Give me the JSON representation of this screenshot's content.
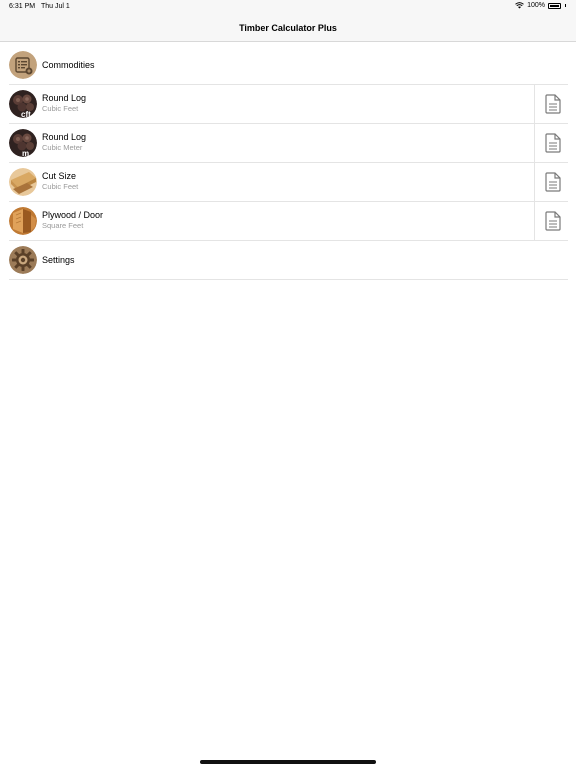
{
  "status": {
    "time": "6:31 PM",
    "date": "Thu Jul 1",
    "battery": "100%",
    "battery_level": 1.0
  },
  "nav": {
    "title": "Timber Calculator Plus"
  },
  "items": [
    {
      "title": "Commodities",
      "subtitle": "",
      "icon": "commodities-icon",
      "color": "#b89870"
    },
    {
      "title": "Round Log",
      "subtitle": "Cubic Feet",
      "icon": "round-log-cft-icon",
      "color": "#4a3330"
    },
    {
      "title": "Round Log",
      "subtitle": "Cubic Meter",
      "icon": "round-log-cbm-icon",
      "color": "#4a3330"
    },
    {
      "title": "Cut Size",
      "subtitle": "Cubic Feet",
      "icon": "cut-size-icon",
      "color": "#d2a870"
    },
    {
      "title": "Plywood / Door",
      "subtitle": "Square Feet",
      "icon": "plywood-icon",
      "color": "#b5702c"
    },
    {
      "title": "Settings",
      "subtitle": "",
      "icon": "settings-gear-icon",
      "color": "#8b6a48"
    }
  ],
  "icon_glyphs": {
    "round_log_cft": "cft",
    "round_log_cbm": "m"
  }
}
